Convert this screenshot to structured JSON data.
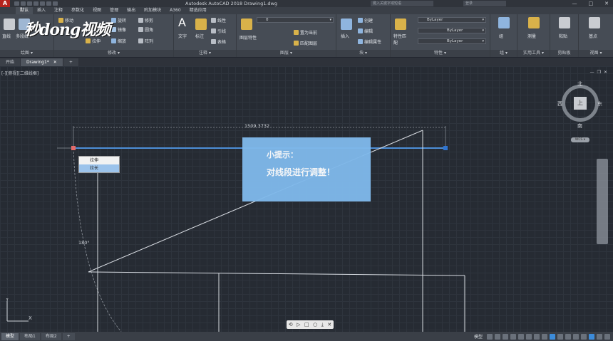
{
  "window": {
    "app_button": "A",
    "title": "Autodesk AutoCAD 2018    Drawing1.dwg",
    "search_placeholder": "键入关键字或短语",
    "login_label": "登录",
    "minimize": "—",
    "maximize": "□",
    "close": "✕"
  },
  "ribbon_tabs": [
    "默认",
    "插入",
    "注释",
    "参数化",
    "视图",
    "管理",
    "输出",
    "附加模块",
    "A360",
    "精选应用"
  ],
  "ribbon_tabs_active_index": 0,
  "ribbon": {
    "draw": {
      "title": "绘图 ▾",
      "items": [
        "直线",
        "多段线"
      ]
    },
    "modify": {
      "title": "修改 ▾",
      "items": [
        "移动",
        "旋转",
        "修剪",
        "复制",
        "镜像",
        "圆角",
        "拉伸",
        "缩放",
        "阵列"
      ]
    },
    "annotation": {
      "title": "注释 ▾",
      "items": [
        "文字",
        "标注",
        "线性",
        "引线",
        "表格"
      ]
    },
    "layers": {
      "title": "图层 ▾",
      "layer_value": "0",
      "items": [
        "图层特性",
        "置为当前",
        "匹配图层"
      ]
    },
    "block": {
      "title": "块 ▾",
      "items": [
        "插入",
        "创建",
        "编辑",
        "编辑属性"
      ]
    },
    "properties": {
      "title": "特性 ▾",
      "items": [
        "特性匹配"
      ],
      "color": "ByLayer",
      "linetype": "ByLayer",
      "lineweight": "ByLayer"
    },
    "groups": {
      "title": "组 ▾",
      "items": [
        "组"
      ]
    },
    "utilities": {
      "title": "实用工具 ▾",
      "items": [
        "测量"
      ]
    },
    "clipboard": {
      "title": "剪贴板",
      "items": [
        "粘贴"
      ]
    },
    "view": {
      "title": "视图 ▾",
      "items": [
        "基点"
      ]
    }
  },
  "logo_text": "秒dong视频",
  "file_tabs": [
    {
      "label": "开始",
      "active": false
    },
    {
      "label": "Drawing1*",
      "active": true
    }
  ],
  "file_tab_add": "+",
  "file_tab_close": "✕",
  "canvas": {
    "view_label": "[-][俯视][二维线框]",
    "vp_minimize": "—",
    "vp_restore": "❐",
    "vp_close": "✕",
    "dimension_value": "1509.3732",
    "angle_value": "180°"
  },
  "context_menu": {
    "items": [
      "拉伸",
      "拉长"
    ],
    "selected_index": 1
  },
  "tip": {
    "title": "小提示：",
    "body": "对线段进行调整！"
  },
  "viewcube": {
    "north": "北",
    "south": "南",
    "east": "东",
    "west": "西",
    "face": "上",
    "wcs": "WCS ▾"
  },
  "ucs": {
    "x_label": "X",
    "y_label": "Y"
  },
  "player_controls": [
    "⟲",
    "▷",
    "□",
    "○",
    "⤓",
    "✕"
  ],
  "layout_tabs": [
    {
      "label": "模型",
      "active": true
    },
    {
      "label": "布局1",
      "active": false
    },
    {
      "label": "布局2",
      "active": false
    }
  ],
  "layout_add": "+",
  "status": {
    "model_label": "模型"
  },
  "colors": {
    "canvas_bg": "#262b33",
    "selection_blue": "#4d8fd8",
    "tip_box": "#7fb8ea",
    "line_white": "#d8dce2"
  }
}
